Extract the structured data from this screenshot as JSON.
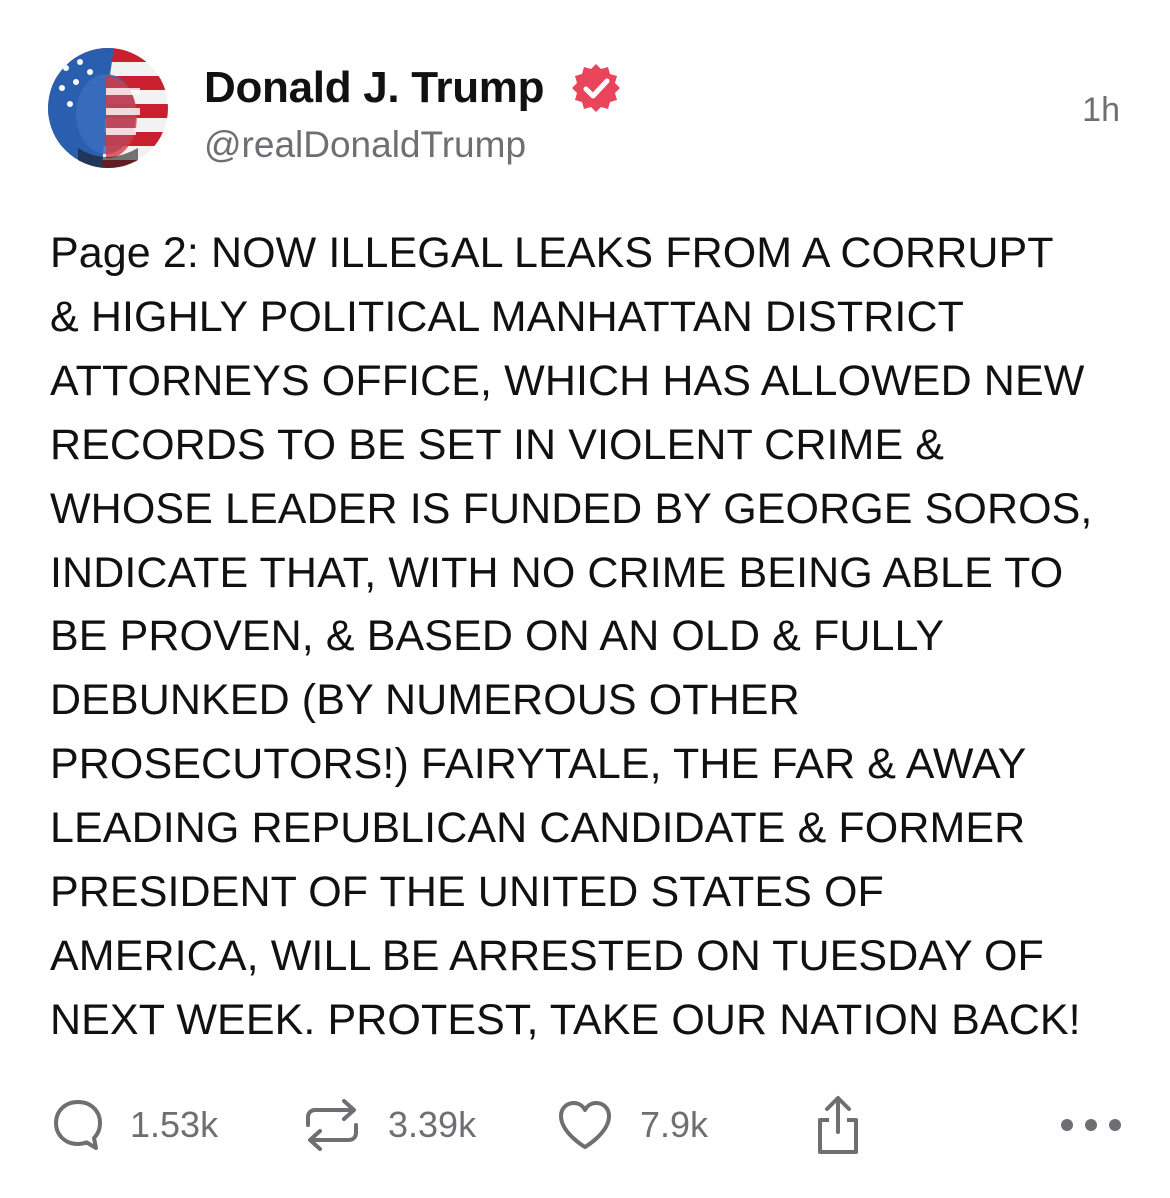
{
  "post": {
    "author_name": "Donald J. Trump",
    "handle": "@realDonaldTrump",
    "timestamp": "1h",
    "verified_icon": "verified-badge-icon",
    "body": "Page 2: NOW ILLEGAL LEAKS FROM A CORRUPT\n& HIGHLY POLITICAL MANHATTAN DISTRICT\nATTORNEYS OFFICE, WHICH HAS ALLOWED NEW\nRECORDS TO BE SET IN VIOLENT CRIME &\nWHOSE LEADER IS FUNDED BY GEORGE SOROS,\nINDICATE THAT, WITH NO CRIME BEING ABLE TO\nBE PROVEN, & BASED ON AN OLD & FULLY\nDEBUNKED (BY NUMEROUS OTHER\nPROSECUTORS!) FAIRYTALE, THE FAR & AWAY\nLEADING REPUBLICAN CANDIDATE & FORMER\nPRESIDENT OF THE UNITED STATES OF\nAMERICA, WILL BE ARRESTED ON TUESDAY OF\nNEXT WEEK. PROTEST, TAKE OUR NATION BACK!"
  },
  "actions": {
    "replies": "1.53k",
    "reposts": "3.39k",
    "likes": "7.9k"
  },
  "colors": {
    "accent": "#e8455a",
    "text": "#111111",
    "muted": "#6e6e73",
    "background": "#ffffff"
  }
}
